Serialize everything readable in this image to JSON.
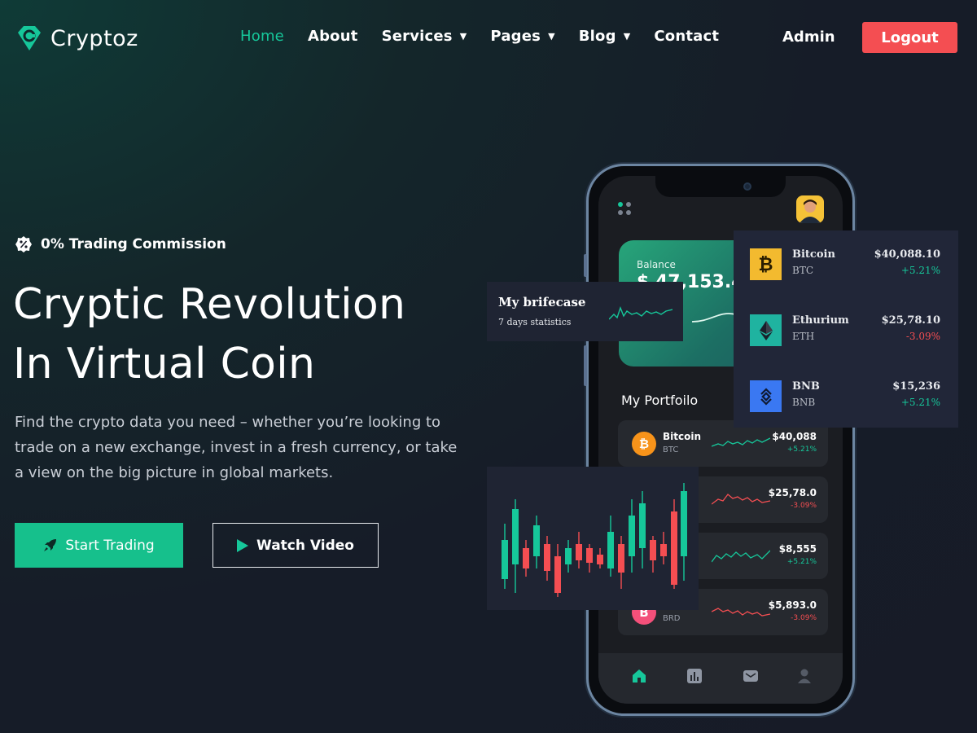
{
  "brand": {
    "name": "Cryptoz",
    "accent": "#16c79a",
    "danger": "#f44e52"
  },
  "nav": {
    "items": [
      {
        "label": "Home",
        "active": true,
        "dropdown": false
      },
      {
        "label": "About",
        "active": false,
        "dropdown": false
      },
      {
        "label": "Services",
        "active": false,
        "dropdown": true
      },
      {
        "label": "Pages",
        "active": false,
        "dropdown": true
      },
      {
        "label": "Blog",
        "active": false,
        "dropdown": true
      },
      {
        "label": "Contact",
        "active": false,
        "dropdown": false
      }
    ],
    "admin": "Admin",
    "logout": "Logout"
  },
  "hero": {
    "badge": "0% Trading Commission",
    "headline_line1": "Cryptic Revolution",
    "headline_line2": "In Virtual Coin",
    "description": "Find the crypto data you need – whether you’re looking to trade on a new exchange, invest in a fresh currency, or take a view on the big picture in global markets.",
    "start_trading": "Start Trading",
    "watch_video": "Watch Video"
  },
  "phone": {
    "balance_label": "Balance",
    "balance_value": "$ 47,153.45",
    "portfolio_title": "My Portfoilo",
    "portfolio": [
      {
        "name": "Bitcoin",
        "symbol": "BTC",
        "value": "$40,088",
        "change": "+5.21%",
        "trend": "up",
        "coin_color": "#f7931a",
        "coin_glyph": "₿"
      },
      {
        "name": "m",
        "symbol": "",
        "value": "$25,78.0",
        "change": "-3.09%",
        "trend": "down",
        "coin_color": "#26292f",
        "coin_glyph": ""
      },
      {
        "name": "nd",
        "symbol": "",
        "value": "$8,555",
        "change": "+5.21%",
        "trend": "up",
        "coin_color": "#26292f",
        "coin_glyph": ""
      },
      {
        "name": "",
        "symbol": "BRD",
        "value": "$5,893.0",
        "change": "-3.09%",
        "trend": "down",
        "coin_color": "#f4507a",
        "coin_glyph": "B"
      }
    ],
    "tabs": [
      "home-icon",
      "chart-icon",
      "mail-icon",
      "user-icon"
    ]
  },
  "briefcase": {
    "title": "My brifecase",
    "subtitle": "7 days statistics"
  },
  "market": [
    {
      "name": "Bitcoin",
      "symbol": "BTC",
      "value": "$40,088.10",
      "change": "+5.21%",
      "trend": "up",
      "icon_bg": "#f3ba2f",
      "icon": "bitcoin-icon"
    },
    {
      "name": "Ethurium",
      "symbol": "ETH",
      "value": "$25,78.10",
      "change": "-3.09%",
      "trend": "down",
      "icon_bg": "#1fb3a0",
      "icon": "ethereum-icon"
    },
    {
      "name": "BNB",
      "symbol": "BNB",
      "value": "$15,236",
      "change": "+5.21%",
      "trend": "up",
      "icon_bg": "#3a78f2",
      "icon": "bnb-icon"
    }
  ]
}
